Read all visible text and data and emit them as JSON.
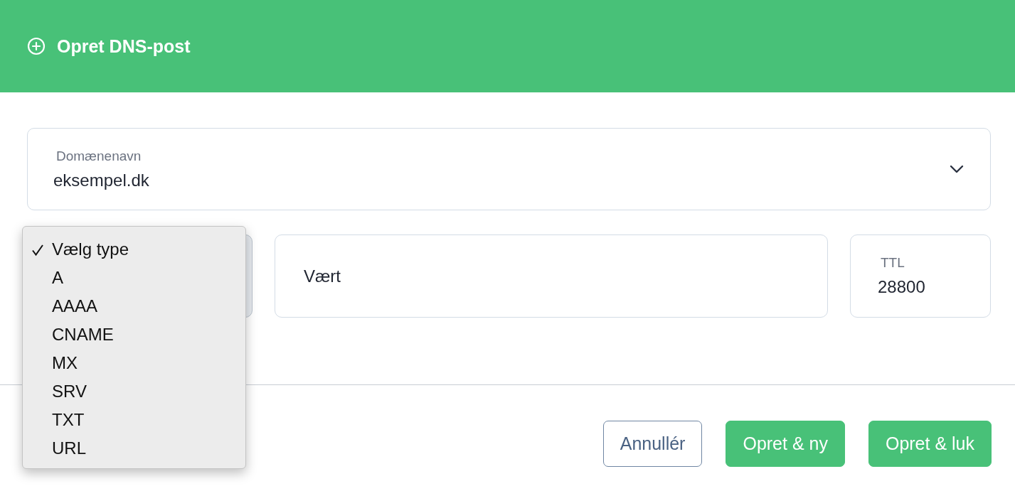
{
  "header": {
    "title": "Opret DNS-post"
  },
  "domain_field": {
    "label": "Domænenavn",
    "value": "eksempel.dk"
  },
  "type_select": {
    "expanded": true,
    "options": [
      {
        "label": "Vælg type",
        "selected": true
      },
      {
        "label": "A",
        "selected": false
      },
      {
        "label": "AAAA",
        "selected": false
      },
      {
        "label": "CNAME",
        "selected": false
      },
      {
        "label": "MX",
        "selected": false
      },
      {
        "label": "SRV",
        "selected": false
      },
      {
        "label": "TXT",
        "selected": false
      },
      {
        "label": "URL",
        "selected": false
      }
    ]
  },
  "host_field": {
    "placeholder": "Vært"
  },
  "ttl_field": {
    "label": "TTL",
    "value": "28800"
  },
  "buttons": [
    {
      "label": "Annullér",
      "kind": "secondary"
    },
    {
      "label": "Opret & ny",
      "kind": "primary"
    },
    {
      "label": "Opret & luk",
      "kind": "primary"
    }
  ]
}
